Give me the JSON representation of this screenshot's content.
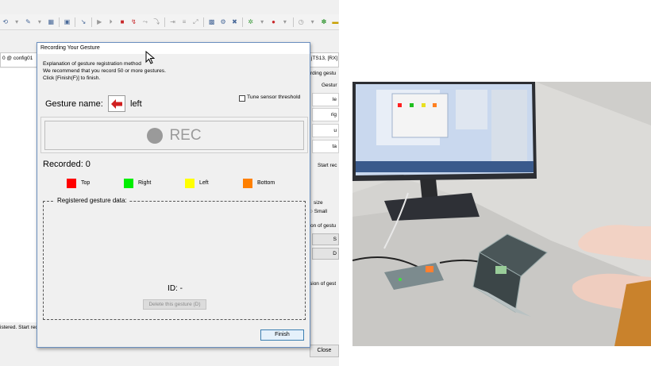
{
  "ide": {
    "left_tab": "0 @ config01",
    "right_header": "jTS13, [RX]",
    "right_labels": {
      "rding": "rding gestu",
      "gesture_col": "Gestur",
      "start_rec": "Start rec",
      "size": "size",
      "small": "Small",
      "on_of_gesture": "on of gestu",
      "sion_of_gesture": "sion of gest"
    },
    "right_cells": [
      "le",
      "rig",
      "u",
      "ta"
    ],
    "right_buttons": [
      "S",
      "D"
    ],
    "left_status": "istered. Start reco",
    "close_button": "Close"
  },
  "dialog": {
    "title": "Recording Your Gesture",
    "explanation": [
      "Explanation of gesture registration method",
      "We recommend that you record 50 or more gestures.",
      "Click [Finish(F)] to finish."
    ],
    "gesture_label": "Gesture name:",
    "gesture_value": "left",
    "tune_label": "Tune sensor threshold",
    "rec_label": "REC",
    "recorded_label": "Recorded: 0",
    "legend": [
      {
        "label": "Top",
        "color": "#ff0000"
      },
      {
        "label": "Right",
        "color": "#00ee00"
      },
      {
        "label": "Left",
        "color": "#ffff00"
      },
      {
        "label": "Bottom",
        "color": "#ff8000"
      }
    ],
    "registered_title": "Registered gesture data:",
    "id_label": "ID: -",
    "delete_button": "Delete this gesture (D)",
    "finish_button": "Finish"
  },
  "colors": {
    "accent_blue": "#6a8fbf",
    "arrow_red": "#d02020"
  }
}
